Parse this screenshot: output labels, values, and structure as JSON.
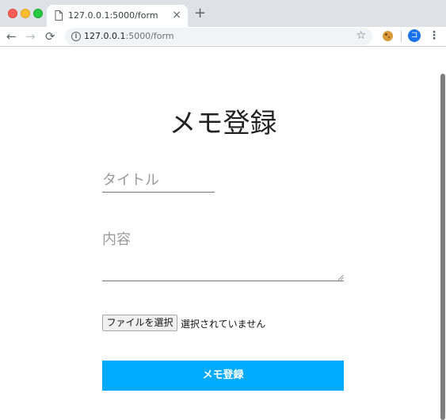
{
  "browser": {
    "tab_title": "127.0.0.1:5000/form",
    "tab_close": "×",
    "new_tab": "+",
    "url_host": "127.0.0.1",
    "url_rest": ":5000/form",
    "avatar_letter": "コ",
    "icons": [
      "page-icon",
      "back-icon",
      "forward-icon",
      "reload-icon",
      "info-icon",
      "star-icon",
      "cookie-extension-icon",
      "menu-icon"
    ]
  },
  "page": {
    "title": "メモ登録",
    "title_placeholder": "タイトル",
    "content_placeholder": "内容",
    "file_button": "ファイルを選択",
    "file_status": "選択されていません",
    "submit_label": "メモ登録"
  }
}
